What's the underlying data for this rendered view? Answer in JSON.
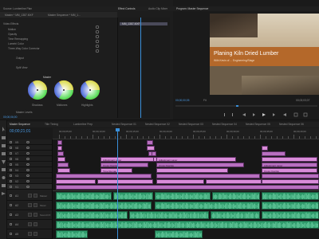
{
  "app": {
    "top_tabs": [
      "Source: Lumberline Plan",
      "Effect Controls",
      "Audio Clip Mixer",
      "Program: Master Sequence"
    ],
    "effects_header": [
      "Master * MM_1387.MXF",
      "Master Sequence * MM_1..."
    ]
  },
  "effect_controls": {
    "clip_label": "MM_1387.MXF",
    "sections": [
      {
        "label": "Video Effects"
      },
      {
        "label": "Motion"
      },
      {
        "label": "Opacity"
      },
      {
        "label": "Time Remapping"
      },
      {
        "label": "Lumetri Color"
      },
      {
        "label": "Three-Way Color Corrector"
      }
    ],
    "sub_rows": [
      "Output",
      "Split View"
    ],
    "wheels_title": "Master",
    "wheel_labels": [
      "Shadows",
      "Midtones",
      "Highlights"
    ],
    "bottom_row": "Master Levels",
    "timecode": "00;00;06;00"
  },
  "program": {
    "title_card": "Planing Kiln Dried Lumber",
    "subtitle_card": "With Kevin of ... Engineering/Stage",
    "timecode": "00;00;00;05",
    "fit_label": "Fit",
    "right_timecode": "00;03;03;07",
    "colors": {
      "title_band": "#b4682a",
      "sky": "#c9b89a"
    }
  },
  "timeline": {
    "tabs": [
      "Master Sequence",
      "Title Timing",
      "Lumberline Prep",
      "Nested Sequence 01",
      "Nested Sequence 02",
      "Nested Sequence 03",
      "Nested Sequence 04",
      "Nested Sequence 05",
      "Nested Sequence 06"
    ],
    "timecode": "00;00;21;01",
    "ruler": [
      "00;00;05;00",
      "00;00;10;00",
      "00;00;15;00",
      "00;00;20;00",
      "00;00;25;00",
      "00;00;30;00",
      "00;00;35;00",
      "00;00;40;00"
    ],
    "video_tracks": [
      "V9",
      "V8",
      "V7",
      "V6",
      "V5",
      "V4",
      "V3",
      "V2",
      "V1"
    ],
    "audio_tracks": [
      "A1",
      "A2",
      "A3",
      "A4",
      "A5"
    ],
    "audio_labels": [
      "Master",
      "Music",
      "Sound FX"
    ],
    "clip_labels": [
      "Adjustment Layer",
      "Cross Overlay",
      "Time Remap",
      "Adjustment Layer",
      "Cross Overlay",
      "Adjustment Layer",
      "Cross Overlay"
    ],
    "colors": {
      "video_clip": "#d98cd9",
      "video_clip_dark": "#b86fc0",
      "audio_clip": "#2f9a6b",
      "playhead": "#3a8fd9"
    }
  }
}
